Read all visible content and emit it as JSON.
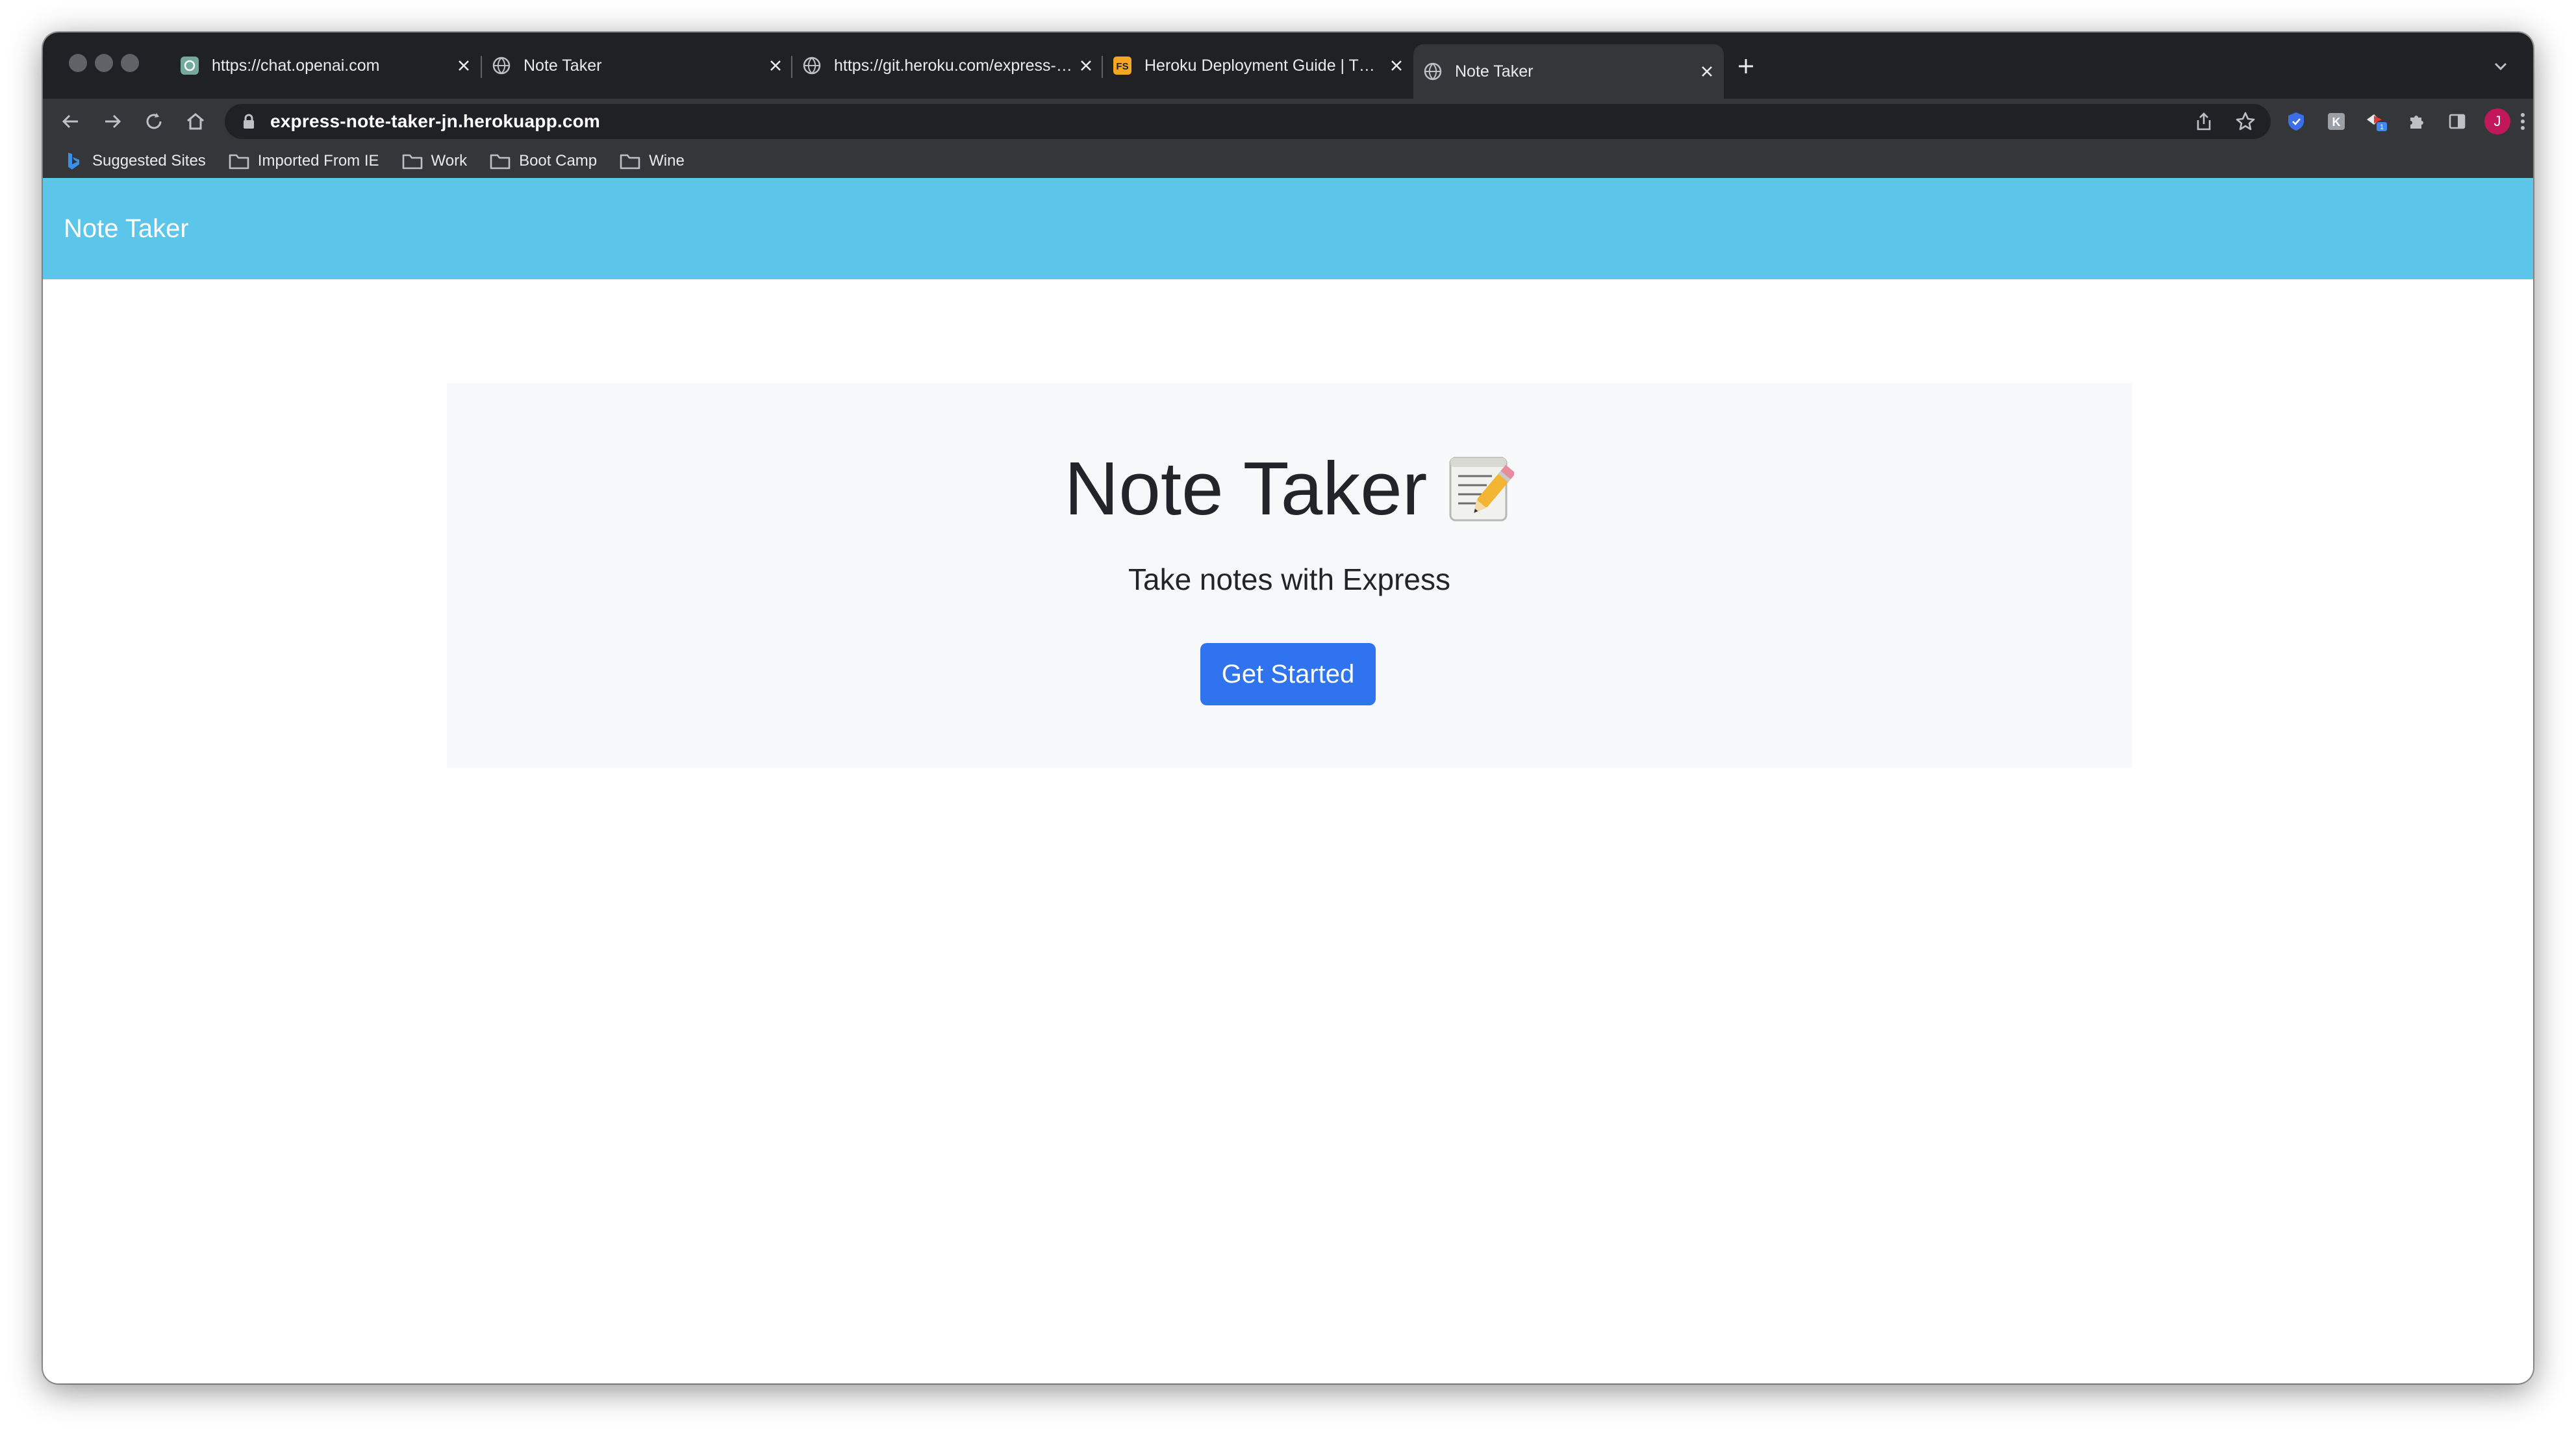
{
  "browser": {
    "tabs": [
      {
        "title": "https://chat.openai.com",
        "icon": "openai-icon",
        "active": false
      },
      {
        "title": "Note Taker",
        "icon": "globe-icon",
        "active": false
      },
      {
        "title": "https://git.heroku.com/express-note-taker-jn.git",
        "icon": "globe-icon",
        "active": false
      },
      {
        "title": "Heroku Deployment Guide | The Full-Stack Blog",
        "icon": "heroku-icon",
        "active": false
      },
      {
        "title": "Note Taker",
        "icon": "globe-icon",
        "active": true
      }
    ],
    "address_bar": {
      "url": "express-note-taker-jn.herokuapp.com"
    },
    "profile_initial": "J",
    "bookmarks": [
      {
        "label": "Suggested Sites",
        "icon": "bing-icon"
      },
      {
        "label": "Imported From IE",
        "icon": "folder-icon"
      },
      {
        "label": "Work",
        "icon": "folder-icon"
      },
      {
        "label": "Boot Camp",
        "icon": "folder-icon"
      },
      {
        "label": "Wine",
        "icon": "folder-icon"
      }
    ]
  },
  "page": {
    "navbar": {
      "brand": "Note Taker",
      "color": "#5bc5ea"
    },
    "hero": {
      "title": "Note Taker",
      "emoji": "memo-icon",
      "subtitle": "Take notes with Express",
      "button_label": "Get Started",
      "button_color": "#2f74ee"
    }
  }
}
